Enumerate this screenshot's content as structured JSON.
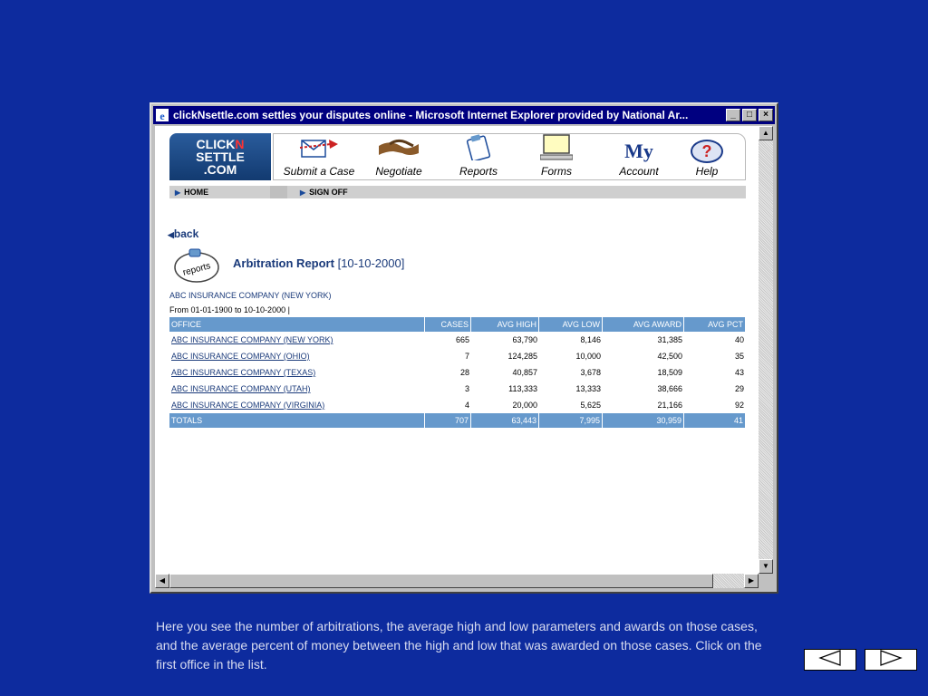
{
  "window": {
    "title": "clickNsettle.com settles your disputes online - Microsoft Internet Explorer provided by National Ar...",
    "controls": {
      "minimize": "_",
      "maximize": "□",
      "close": "×"
    }
  },
  "site": {
    "logo": {
      "line1a": "CLICK",
      "line1b": "N",
      "line2": "SETTLE",
      "line3": ".COM"
    },
    "nav": [
      {
        "label": "Submit a Case",
        "icon": "envelope-arrow-icon"
      },
      {
        "label": "Negotiate",
        "icon": "handshake-icon"
      },
      {
        "label": "Reports",
        "icon": "clipboard-icon"
      },
      {
        "label": "Forms",
        "icon": "computer-icon"
      },
      {
        "label": "Account",
        "icon": "my-icon",
        "icon_text": "My"
      },
      {
        "label": "Help",
        "icon": "help-icon",
        "icon_text": "?"
      }
    ],
    "subnav": {
      "home": "HOME",
      "signoff": "SIGN OFF"
    }
  },
  "page": {
    "back": "back",
    "icon_text": "reports",
    "report_title": "Arbitration Report",
    "report_date": "[10-10-2000]",
    "company": "ABC INSURANCE COMPANY (NEW YORK)",
    "range": "From 01-01-1900 to 10-10-2000 |"
  },
  "table": {
    "headers": [
      "OFFICE",
      "CASES",
      "AVG HIGH",
      "AVG LOW",
      "AVG AWARD",
      "AVG PCT"
    ],
    "rows": [
      [
        "ABC INSURANCE COMPANY (NEW YORK)",
        "665",
        "63,790",
        "8,146",
        "31,385",
        "40"
      ],
      [
        "ABC INSURANCE COMPANY (OHIO)",
        "7",
        "124,285",
        "10,000",
        "42,500",
        "35"
      ],
      [
        "ABC INSURANCE COMPANY (TEXAS)",
        "28",
        "40,857",
        "3,678",
        "18,509",
        "43"
      ],
      [
        "ABC INSURANCE COMPANY (UTAH)",
        "3",
        "113,333",
        "13,333",
        "38,666",
        "29"
      ],
      [
        "ABC INSURANCE COMPANY (VIRGINIA)",
        "4",
        "20,000",
        "5,625",
        "21,166",
        "92"
      ]
    ],
    "totals": [
      "TOTALS",
      "707",
      "63,443",
      "7,995",
      "30,959",
      "41"
    ]
  },
  "caption": "Here you see the number of arbitrations, the average high and low parameters and awards on those cases, and the average percent of money between the high and low that was awarded on those cases.  Click on the first office in the list.",
  "colors": {
    "background": "#0d2b9e",
    "header": "#6699cc",
    "titlebar": "#000080"
  }
}
